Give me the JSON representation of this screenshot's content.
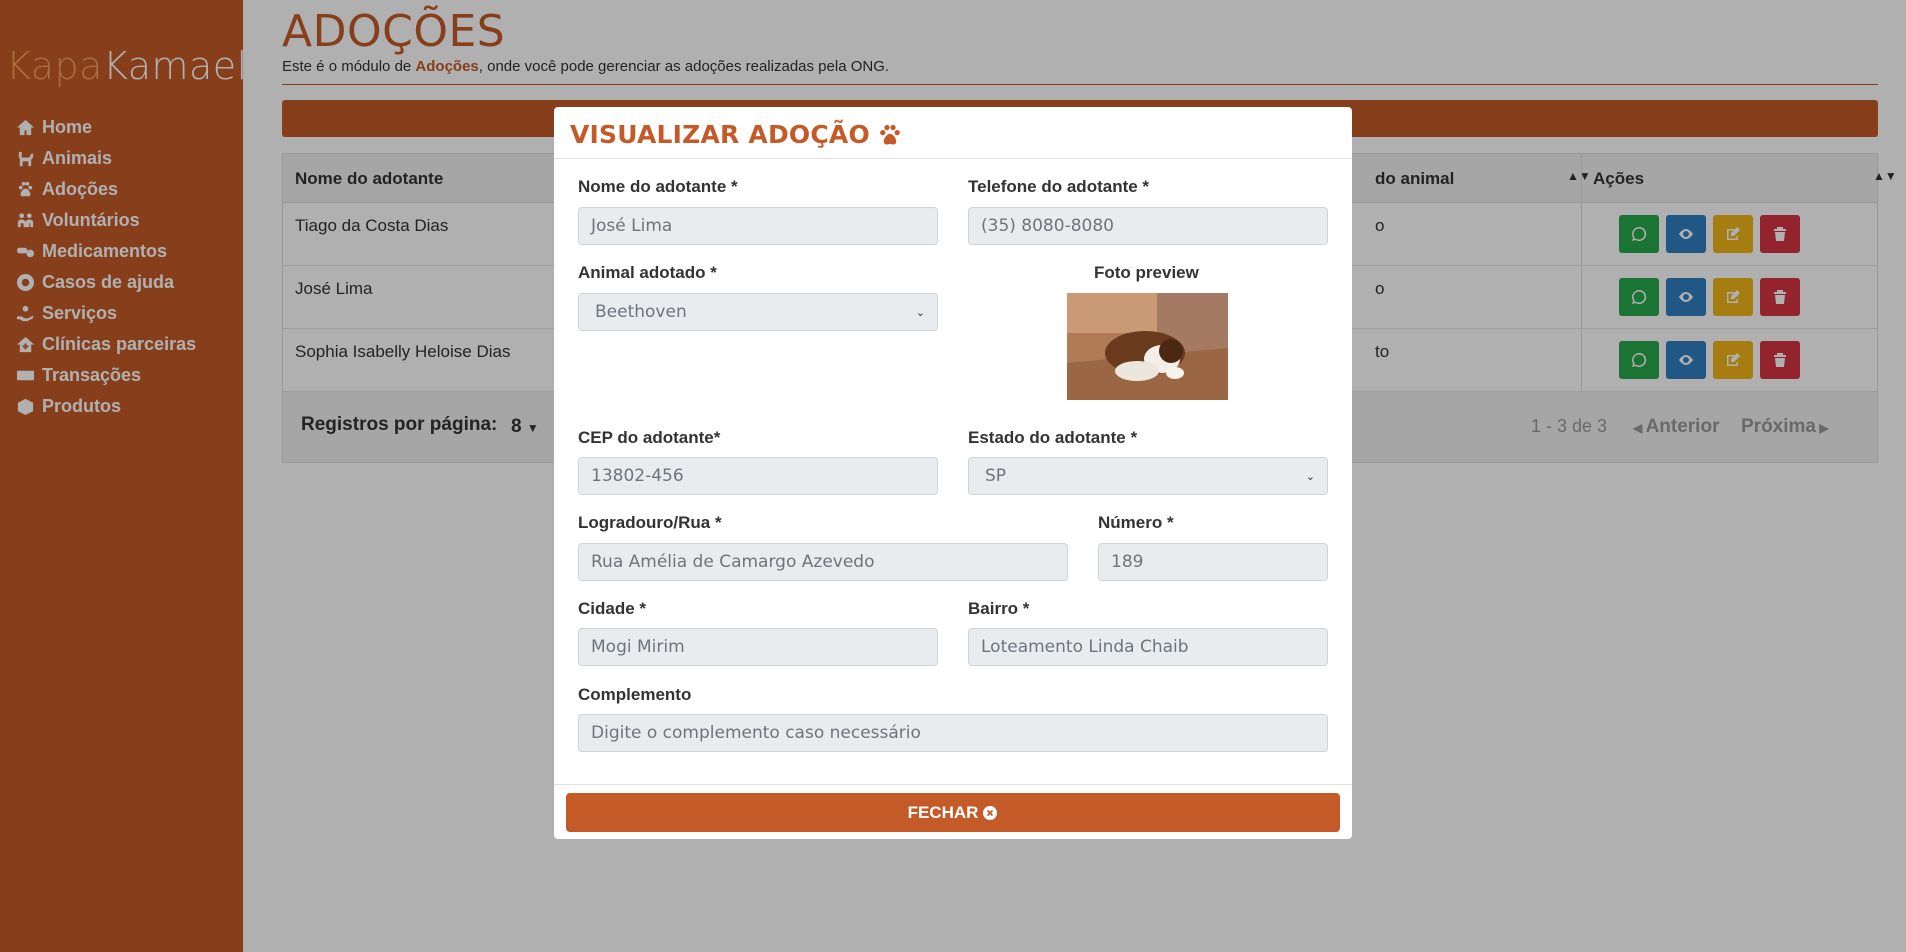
{
  "brand": {
    "part1": "Kapa",
    "part2": "Kamael"
  },
  "sidebar": {
    "items": [
      {
        "label": "Home",
        "icon": "home-icon"
      },
      {
        "label": "Animais",
        "icon": "dog-icon"
      },
      {
        "label": "Adoções",
        "icon": "paw-icon"
      },
      {
        "label": "Voluntários",
        "icon": "people-icon"
      },
      {
        "label": "Medicamentos",
        "icon": "pills-icon"
      },
      {
        "label": "Casos de ajuda",
        "icon": "lifebuoy-icon"
      },
      {
        "label": "Serviços",
        "icon": "hand-icon"
      },
      {
        "label": "Clínicas parceiras",
        "icon": "clinic-icon"
      },
      {
        "label": "Transações",
        "icon": "money-icon"
      },
      {
        "label": "Produtos",
        "icon": "box-icon"
      }
    ]
  },
  "page": {
    "title": "ADOÇÕES",
    "desc_before": "Este é o módulo de ",
    "desc_bold": "Adoções",
    "desc_after": ", onde você pode gerenciar as adoções realizadas pela ONG."
  },
  "table": {
    "headers": {
      "name": "Nome do adotante",
      "animal": "do animal",
      "actions": "Ações"
    },
    "rows": [
      {
        "name": "Tiago da Costa Dias",
        "tail": "o"
      },
      {
        "name": "José Lima",
        "tail": "o"
      },
      {
        "name": "Sophia Isabelly Heloise Dias",
        "tail": "to"
      }
    ],
    "footer": {
      "per_page_label": "Registros por página:",
      "per_page_value": "8",
      "range": "1 - 3 de 3",
      "prev": "Anterior",
      "next": "Próxima"
    }
  },
  "modal": {
    "title": "VISUALIZAR ADOÇÃO",
    "fields": {
      "nome_label": "Nome do adotante *",
      "nome_value": "José Lima",
      "telefone_label": "Telefone do adotante *",
      "telefone_value": "(35) 8080-8080",
      "animal_label": "Animal adotado *",
      "animal_value": "Beethoven",
      "foto_label": "Foto preview",
      "cep_label": "CEP do adotante*",
      "cep_value": "13802-456",
      "estado_label": "Estado do adotante *",
      "estado_value": "SP",
      "logradouro_label": "Logradouro/Rua *",
      "logradouro_value": "Rua Amélia de Camargo Azevedo",
      "numero_label": "Número *",
      "numero_value": "189",
      "cidade_label": "Cidade *",
      "cidade_value": "Mogi Mirim",
      "bairro_label": "Bairro *",
      "bairro_value": "Loteamento Linda Chaib",
      "complemento_label": "Complemento",
      "complemento_placeholder": "Digite o complemento caso necessário"
    },
    "close_label": "FECHAR"
  },
  "colors": {
    "accent": "#c45a28",
    "whatsapp": "#27a84a",
    "view": "#2f7fbf",
    "edit": "#f0b51a",
    "delete": "#d63340"
  }
}
